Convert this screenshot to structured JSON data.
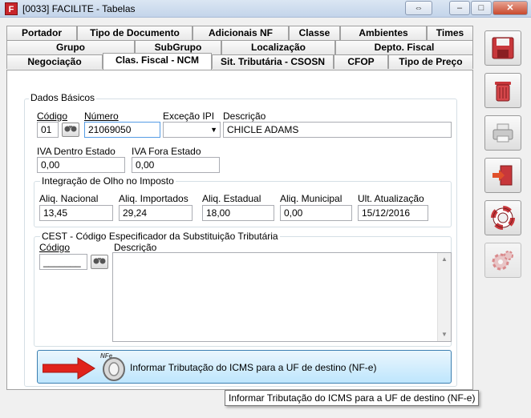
{
  "window": {
    "title": "[0033] FACILITE - Tabelas",
    "icon_letter": "F",
    "restore_glyph": "⇔",
    "minimize_glyph": "–",
    "maximize_glyph": "□",
    "close_glyph": "✕"
  },
  "tabs": {
    "row_top": [
      "Portador",
      "Tipo de Documento",
      "Adicionais NF",
      "Classe",
      "Ambientes",
      "Times"
    ],
    "row_mid": [
      "Grupo",
      "SubGrupo",
      "Localização",
      "Depto. Fiscal"
    ],
    "row_bottom": [
      "Negociação",
      "Clas. Fiscal - NCM",
      "Sit. Tributária - CSOSN",
      "CFOP",
      "Tipo de Preço"
    ],
    "active": "Clas. Fiscal - NCM"
  },
  "dados_basicos": {
    "title": "Dados Básicos",
    "codigo_label": "Código",
    "codigo_value": "01",
    "numero_label": "Número",
    "numero_value": "21069050",
    "excecao_label": "Exceção IPI",
    "excecao_value": "",
    "descricao_label": "Descrição",
    "descricao_value": "CHICLE ADAMS",
    "iva_dentro_label": "IVA Dentro Estado",
    "iva_dentro_value": "0,00",
    "iva_fora_label": "IVA Fora Estado",
    "iva_fora_value": "0,00"
  },
  "integracao": {
    "title": "Integração de Olho no Imposto",
    "aliq_nacional_label": "Aliq. Nacional",
    "aliq_nacional_value": "13,45",
    "aliq_importados_label": "Aliq. Importados",
    "aliq_importados_value": "29,24",
    "aliq_estadual_label": "Aliq. Estadual",
    "aliq_estadual_value": "18,00",
    "aliq_municipal_label": "Aliq. Municipal",
    "aliq_municipal_value": "0,00",
    "ult_atualizacao_label": "Ult. Atualização",
    "ult_atualizacao_value": "15/12/2016"
  },
  "cest": {
    "title": "CEST - Código Especificador da Substituição Tributária",
    "codigo_label": "Código",
    "codigo_value": "_______",
    "descricao_label": "Descrição",
    "descricao_value": ""
  },
  "action_button": {
    "label": "Informar Tributação do ICMS para a UF de destino (NF-e)",
    "icon_text": "NFe"
  },
  "tooltip": {
    "text": "Informar Tributação do ICMS para a UF de destino (NF-e)"
  },
  "sidebar": {
    "buttons": [
      "save-icon",
      "delete-icon",
      "print-icon",
      "exit-icon",
      "help-icon",
      "settings-icon"
    ]
  },
  "colors": {
    "accent_red": "#e0231b",
    "button_blue": "#bee6fd"
  }
}
